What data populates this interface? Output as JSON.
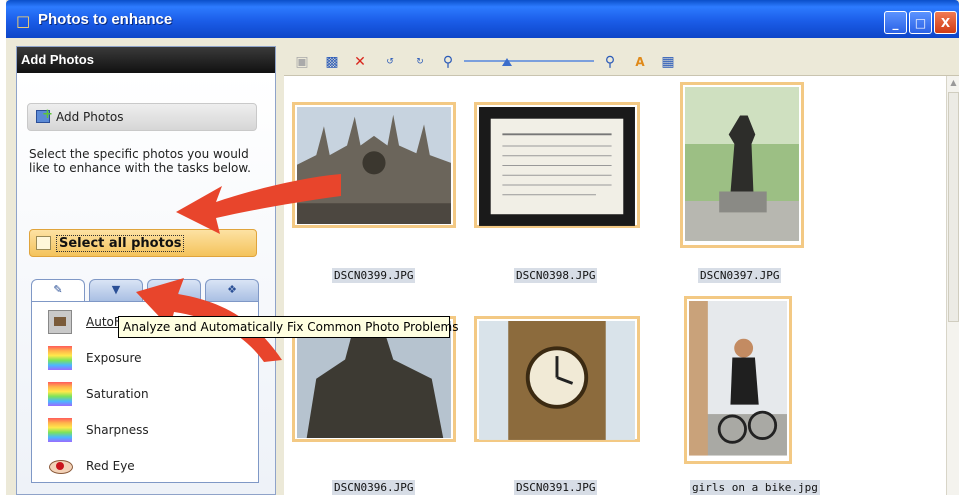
{
  "window": {
    "title": "Photos to enhance"
  },
  "left_panel": {
    "header": "Add Photos",
    "add_button": "Add Photos",
    "instructions": "Select the specific photos you would like to enhance with the tasks below.",
    "select_all": "Select all photos",
    "tasks": [
      {
        "label": "AutoFix",
        "icon": "autofix-icon"
      },
      {
        "label": "Exposure",
        "icon": "exposure-icon"
      },
      {
        "label": "Saturation",
        "icon": "saturation-icon"
      },
      {
        "label": "Sharpness",
        "icon": "sharpness-icon"
      },
      {
        "label": "Red Eye",
        "icon": "red-eye-icon"
      }
    ]
  },
  "tooltip": "Analyze and Automatically Fix Common Photo Problems",
  "photos": [
    {
      "name": "DSCN0399.JPG"
    },
    {
      "name": "DSCN0398.JPG"
    },
    {
      "name": "DSCN0397.JPG"
    },
    {
      "name": "DSCN0396.JPG"
    },
    {
      "name": "DSCN0391.JPG"
    },
    {
      "name": "girls on a bike.jpg"
    }
  ],
  "colors": {
    "titlebar": "#1b5de8",
    "select_highlight": "#f4c35c",
    "thumb_border": "#f3c984",
    "arrow": "#e8452c"
  }
}
